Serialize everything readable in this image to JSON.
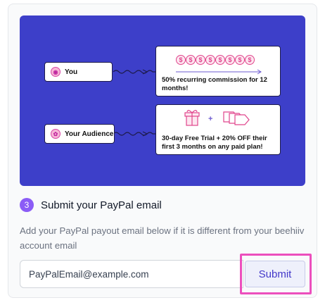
{
  "banner": {
    "you_label": "You",
    "audience_label": "Your Audience",
    "commission_text": "50% recurring commission for 12 months!",
    "trial_text": "30-day Free Trial + 20% OFF their first 3 months on any paid plan!"
  },
  "step": {
    "number": "3",
    "title": "Submit your PayPal email"
  },
  "description": "Add your PayPal payout email below if it is different from your beehiiv account email",
  "email": {
    "value": "PayPalEmail@example.com",
    "placeholder": "PayPalEmail@example.com"
  },
  "submit_label": "Submit",
  "colors": {
    "banner": "#3d3fc9",
    "accent": "#8b5cf6",
    "highlight": "#ec4fbd",
    "submit_text": "#4338ca"
  },
  "icons": [
    "person-icon",
    "audience-icon",
    "dollar-coin-icon",
    "gift-icon",
    "price-tag-icon"
  ]
}
